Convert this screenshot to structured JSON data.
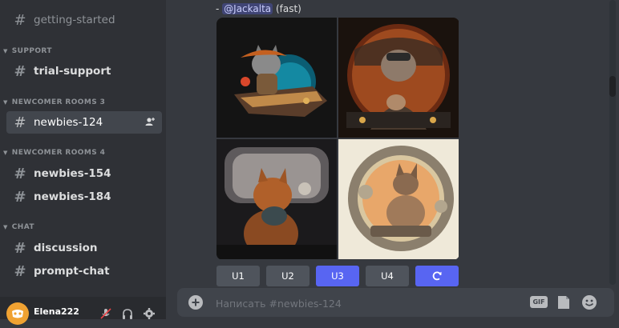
{
  "sidebar": {
    "channels": {
      "getting_started": "getting-started",
      "trial_support": "trial-support",
      "newbies_124": "newbies-124",
      "newbies_154": "newbies-154",
      "newbies_184": "newbies-184",
      "discussion": "discussion",
      "prompt_chat": "prompt-chat"
    },
    "categories": {
      "support": "SUPPORT",
      "newcomer3": "NEWCOMER ROOMS 3",
      "newcomer4": "NEWCOMER ROOMS 4",
      "chat": "CHAT"
    }
  },
  "user": {
    "name": "Elena222"
  },
  "message": {
    "prefix": "- ",
    "mention": "@Jackalta",
    "suffix": " (fast)"
  },
  "buttons": {
    "u1": "U1",
    "u2": "U2",
    "u3": "U3",
    "u4": "U4"
  },
  "composer": {
    "placeholder": "Написать #newbies-124",
    "gif": "GIF"
  },
  "colors": {
    "accent": "#5865f2",
    "sidebar_bg": "#2f3136",
    "chat_bg": "#36393f"
  }
}
